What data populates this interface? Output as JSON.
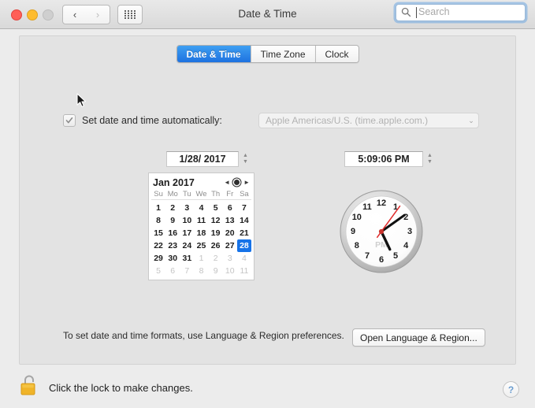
{
  "window": {
    "title": "Date & Time",
    "traffic_lights": [
      "close",
      "minimize",
      "maximize"
    ],
    "nav_back": "‹",
    "nav_forward": "›",
    "show_all_icon": "grid-icon"
  },
  "search": {
    "placeholder": "Search",
    "value": "",
    "icon": "search-icon"
  },
  "tabs": [
    {
      "label": "Date & Time",
      "active": true
    },
    {
      "label": "Time Zone",
      "active": false
    },
    {
      "label": "Clock",
      "active": false
    }
  ],
  "auto": {
    "checkbox_checked": true,
    "checkbox_enabled": false,
    "label": "Set date and time automatically:",
    "server": "Apple Americas/U.S. (time.apple.com.)",
    "chevron": "⌄"
  },
  "date_field": {
    "value": "1/28/ 2017",
    "stepper_up": "▲",
    "stepper_down": "▼"
  },
  "time_field": {
    "value": "5:09:06 PM",
    "stepper_up": "▲",
    "stepper_down": "▼"
  },
  "calendar": {
    "month_label": "Jan 2017",
    "prev_icon": "◄",
    "next_icon": "►",
    "today_icon": "today-dot-icon",
    "weekdays": [
      "Su",
      "Mo",
      "Tu",
      "We",
      "Th",
      "Fr",
      "Sa"
    ],
    "selected_day": 28,
    "weeks": [
      [
        {
          "d": "1",
          "dim": false
        },
        {
          "d": "2",
          "dim": false
        },
        {
          "d": "3",
          "dim": false
        },
        {
          "d": "4",
          "dim": false
        },
        {
          "d": "5",
          "dim": false
        },
        {
          "d": "6",
          "dim": false
        },
        {
          "d": "7",
          "dim": false
        }
      ],
      [
        {
          "d": "8",
          "dim": false
        },
        {
          "d": "9",
          "dim": false
        },
        {
          "d": "10",
          "dim": false
        },
        {
          "d": "11",
          "dim": false
        },
        {
          "d": "12",
          "dim": false
        },
        {
          "d": "13",
          "dim": false
        },
        {
          "d": "14",
          "dim": false
        }
      ],
      [
        {
          "d": "15",
          "dim": false
        },
        {
          "d": "16",
          "dim": false
        },
        {
          "d": "17",
          "dim": false
        },
        {
          "d": "18",
          "dim": false
        },
        {
          "d": "19",
          "dim": false
        },
        {
          "d": "20",
          "dim": false
        },
        {
          "d": "21",
          "dim": false
        }
      ],
      [
        {
          "d": "22",
          "dim": false
        },
        {
          "d": "23",
          "dim": false
        },
        {
          "d": "24",
          "dim": false
        },
        {
          "d": "25",
          "dim": false
        },
        {
          "d": "26",
          "dim": false
        },
        {
          "d": "27",
          "dim": false
        },
        {
          "d": "28",
          "dim": false,
          "sel": true
        }
      ],
      [
        {
          "d": "29",
          "dim": false
        },
        {
          "d": "30",
          "dim": false
        },
        {
          "d": "31",
          "dim": false
        },
        {
          "d": "1",
          "dim": true
        },
        {
          "d": "2",
          "dim": true
        },
        {
          "d": "3",
          "dim": true
        },
        {
          "d": "4",
          "dim": true
        }
      ],
      [
        {
          "d": "5",
          "dim": true
        },
        {
          "d": "6",
          "dim": true
        },
        {
          "d": "7",
          "dim": true
        },
        {
          "d": "8",
          "dim": true
        },
        {
          "d": "9",
          "dim": true
        },
        {
          "d": "10",
          "dim": true
        },
        {
          "d": "11",
          "dim": true
        }
      ]
    ]
  },
  "clock": {
    "hour_numbers": [
      "12",
      "1",
      "2",
      "3",
      "4",
      "5",
      "6",
      "7",
      "8",
      "9",
      "10",
      "11"
    ],
    "meridiem": "PM",
    "hour": 5,
    "minute": 9,
    "second": 6,
    "second_hand_color": "#e02b2b",
    "hand_color": "#111111"
  },
  "formats": {
    "text": "To set date and time formats, use Language & Region preferences.",
    "button_label": "Open Language & Region..."
  },
  "footer": {
    "lock_icon": "unlocked-padlock-icon",
    "lock_text": "Click the lock to make changes.",
    "help_label": "?"
  },
  "colors": {
    "accent_blue": "#1673e8",
    "tab_active_blue": "#1e72e0",
    "lock_gold": "#f0b429",
    "panel_bg": "#e3e3e3",
    "window_bg": "#ececec"
  }
}
